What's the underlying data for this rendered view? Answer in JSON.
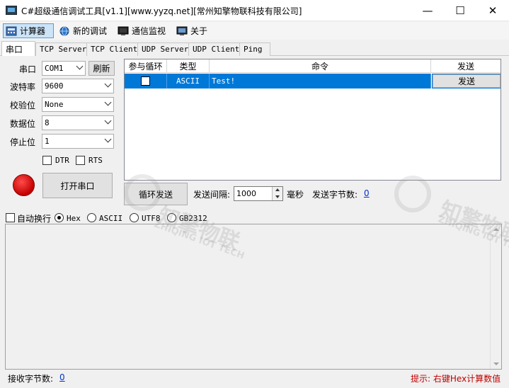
{
  "window": {
    "title": "C#超级通信调试工具[v1.1][www.yyzq.net][常州知擎物联科技有限公司]",
    "minimize": "—",
    "maximize": "☐",
    "close": "✕"
  },
  "menu": {
    "items": [
      {
        "label": "计算器",
        "icon": "calculator-icon"
      },
      {
        "label": "新的调试",
        "icon": "globe-icon"
      },
      {
        "label": "通信监视",
        "icon": "monitor-icon"
      },
      {
        "label": "关于",
        "icon": "info-monitor-icon"
      }
    ]
  },
  "tabs": [
    "串口",
    "TCP Server",
    "TCP Client",
    "UDP Server",
    "UDP Client",
    "Ping"
  ],
  "serial": {
    "port_label": "串口",
    "port_value": "COM1",
    "refresh_label": "刷新",
    "baud_label": "波特率",
    "baud_value": "9600",
    "parity_label": "校验位",
    "parity_value": "None",
    "databits_label": "数据位",
    "databits_value": "8",
    "stopbits_label": "停止位",
    "stopbits_value": "1",
    "dtr_label": "DTR",
    "rts_label": "RTS",
    "open_label": "打开串口",
    "status_color": "#d40000"
  },
  "grid": {
    "headers": [
      "参与循环",
      "类型",
      "命令",
      "发送"
    ],
    "rows": [
      {
        "loop": false,
        "type": "ASCII",
        "command": "Test!",
        "send": "发送"
      }
    ]
  },
  "send_bar": {
    "loop_send_label": "循环发送",
    "interval_label": "发送间隔:",
    "interval_value": "1000",
    "unit_label": "毫秒",
    "bytes_label": "发送字节数:",
    "bytes_value": "0"
  },
  "receive": {
    "auto_wrap_label": "自动换行",
    "format_options": [
      "Hex",
      "ASCII",
      "UTF8",
      "GB2312"
    ],
    "selected_format": "Hex",
    "bytes_label": "接收字节数:",
    "bytes_value": "0",
    "hint": "提示: 右键Hex计算数值",
    "hint_color": "#c00000"
  },
  "watermark": {
    "brand": "知擎物联",
    "brand_en": "ZHIQING IOT TECH"
  }
}
